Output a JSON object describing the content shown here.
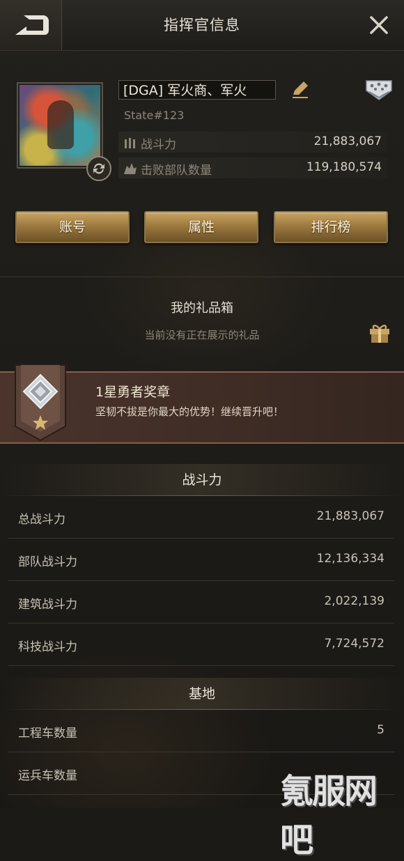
{
  "header": {
    "title": "指挥官信息",
    "back_icon": "back-arrow-icon",
    "close_icon": "close-icon"
  },
  "profile": {
    "name": "[DGA] 军火商、军火",
    "state": "State#123",
    "stats": [
      {
        "icon": "bullets-icon",
        "label": "战斗力",
        "value": "21,883,067"
      },
      {
        "icon": "skull-icon",
        "label": "击败部队数量",
        "value": "119,180,574"
      }
    ]
  },
  "buttons": [
    "账号",
    "属性",
    "排行榜"
  ],
  "gift": {
    "title": "我的礼品箱",
    "subtitle": "当前没有正在展示的礼品",
    "icon": "gift-icon"
  },
  "medal": {
    "title": "1星勇者奖章",
    "description": "坚韧不拔是你最大的优势！继续晋升吧！",
    "icon": "medal-badge-icon"
  },
  "power_section": {
    "title": "战斗力",
    "rows": [
      {
        "label": "总战斗力",
        "value": "21,883,067"
      },
      {
        "label": "部队战斗力",
        "value": "12,136,334"
      },
      {
        "label": "建筑战斗力",
        "value": "2,022,139"
      },
      {
        "label": "科技战斗力",
        "value": "7,724,572"
      }
    ]
  },
  "base_section": {
    "title": "基地",
    "rows": [
      {
        "label": "工程车数量",
        "value": "5"
      },
      {
        "label": "运兵车数量",
        "value": ""
      }
    ]
  },
  "watermark": "氪服网吧",
  "colors": {
    "gold": "#b08c52",
    "medal_bg": "#3e2c25",
    "background": "#1c1a17"
  }
}
